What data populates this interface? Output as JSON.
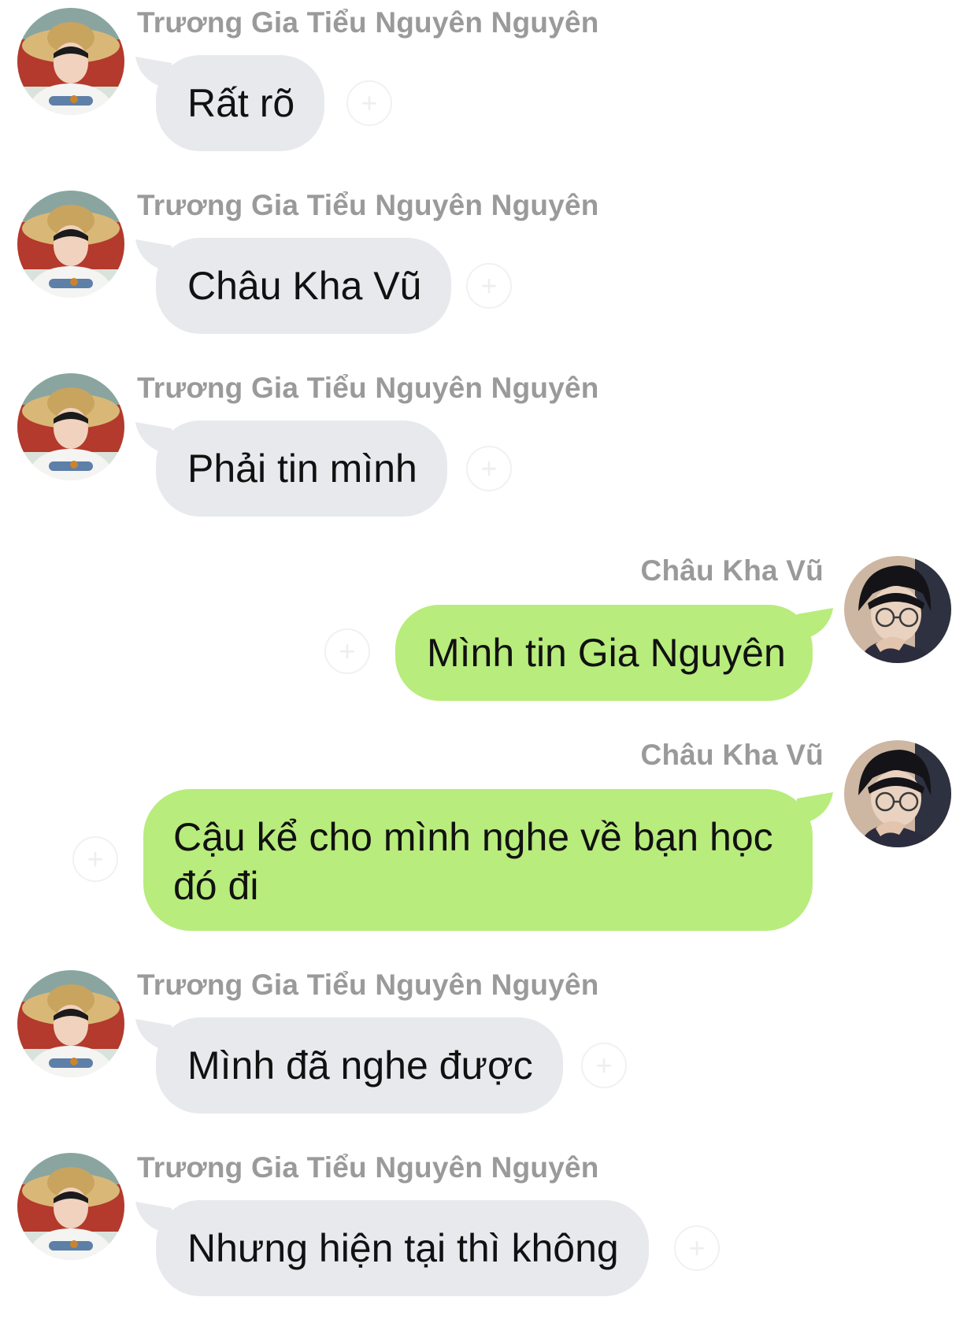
{
  "messages": [
    {
      "sender": "Trương Gia Tiểu Nguyên Nguyên",
      "text": "Rất rõ"
    },
    {
      "sender": "Trương Gia Tiểu Nguyên Nguyên",
      "text": "Châu Kha Vũ"
    },
    {
      "sender": "Trương Gia Tiểu Nguyên Nguyên",
      "text": "Phải tin mình"
    },
    {
      "sender": "Châu Kha Vũ",
      "text": "Mình tin Gia Nguyên"
    },
    {
      "sender": "Châu Kha Vũ",
      "text": "Cậu kể cho mình nghe về bạn học đó đi"
    },
    {
      "sender": "Trương Gia Tiểu Nguyên Nguyên",
      "text": "Mình đã nghe được"
    },
    {
      "sender": "Trương Gia Tiểu Nguyên Nguyên",
      "text": "Nhưng hiện tại thì không"
    }
  ],
  "colors": {
    "incoming_bubble": "#e7e9ec",
    "outgoing_bubble": "#b8ec7c",
    "sender_text": "#9a9a9a"
  },
  "icons": {
    "incoming_avatar": "avatar-straw-hat",
    "outgoing_avatar": "avatar-glasses",
    "reaction": "add-reaction-icon"
  }
}
